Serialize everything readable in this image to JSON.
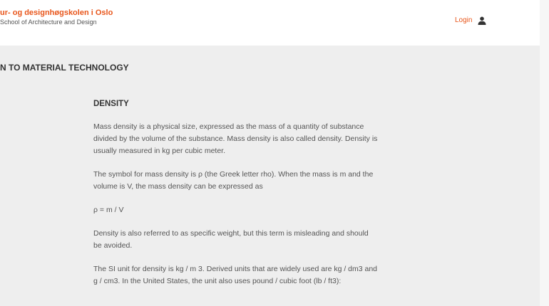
{
  "header": {
    "brand_title": "ur- og designhøgskolen i Oslo",
    "brand_subtitle": "School of Architecture and Design",
    "login_label": "Login",
    "accent_color": "#e8561b",
    "login_icon": "user-icon"
  },
  "main": {
    "course_title": "N TO MATERIAL TECHNOLOGY",
    "article": {
      "heading": "DENSITY",
      "paragraphs": [
        "Mass density is a physical size, expressed as the mass of a quantity of substance divided by the volume of the substance. Mass density is also called density. Density is usually measured in kg per cubic meter.",
        "The symbol for mass density is ρ (the Greek letter rho). When the mass is m and the volume is V, the mass density can be expressed as",
        "ρ = m / V",
        "Density is also referred to as specific weight, but this term is misleading and should be avoided.",
        "The SI unit for density is kg / m 3. Derived units that are widely used are kg / dm3 and g / cm3. In the United States, the unit also uses pound / cubic foot (lb / ft3):"
      ]
    }
  }
}
